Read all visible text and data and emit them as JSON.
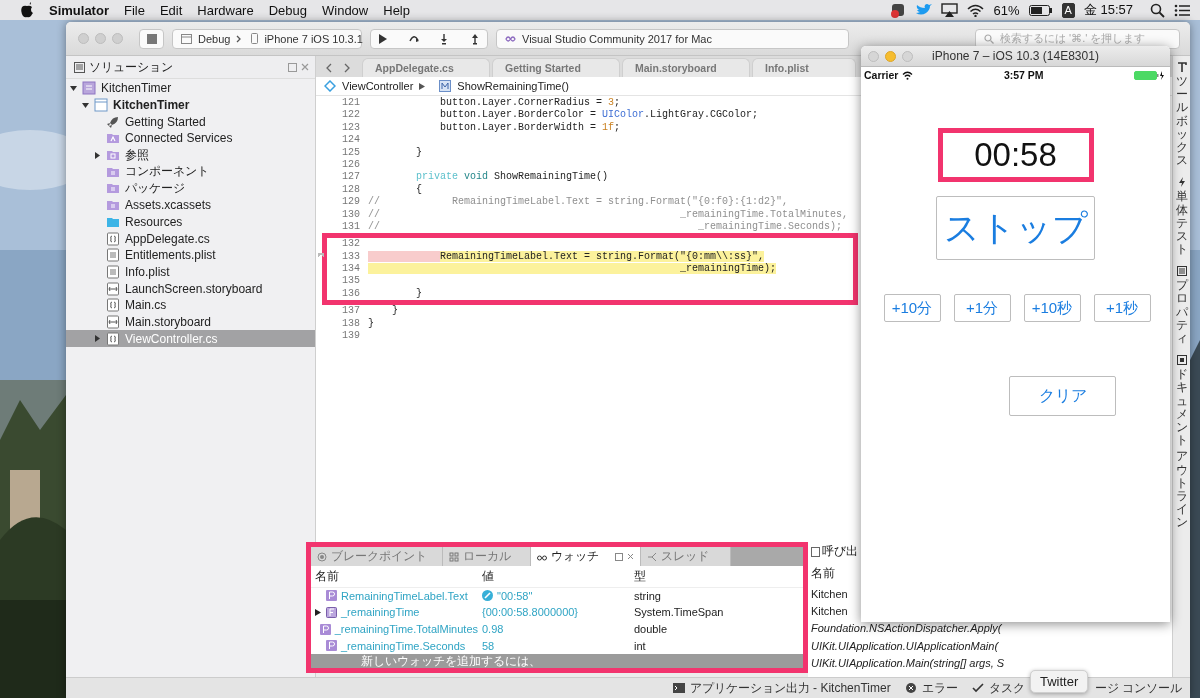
{
  "menubar": {
    "app_name": "Simulator",
    "menus": [
      "File",
      "Edit",
      "Hardware",
      "Debug",
      "Window",
      "Help"
    ],
    "battery_percent": "61%",
    "input_source": "A",
    "clock": "金 15:57"
  },
  "toolbar": {
    "configuration": "Debug",
    "device": "iPhone 7 iOS 10.3.1",
    "status": "Visual Studio Community 2017 for Mac",
    "search_placeholder": "検索するには '⌘.' を押します"
  },
  "solution_pad": {
    "title": "ソリューション",
    "tree": [
      {
        "label": "KitchenTimer",
        "kind": "solution",
        "expanded": true,
        "selected": false,
        "children": [
          {
            "label": "KitchenTimer",
            "kind": "project",
            "expanded": true,
            "selected": false,
            "children": [
              {
                "label": "Getting Started",
                "kind": "rocket",
                "selected": false
              },
              {
                "label": "Connected Services",
                "kind": "services",
                "selected": false
              },
              {
                "label": "参照",
                "kind": "references",
                "expanded": false,
                "selected": false
              },
              {
                "label": "コンポーネント",
                "kind": "special-folder",
                "selected": false
              },
              {
                "label": "パッケージ",
                "kind": "special-folder",
                "selected": false
              },
              {
                "label": "Assets.xcassets",
                "kind": "special-folder",
                "selected": false
              },
              {
                "label": "Resources",
                "kind": "folder",
                "selected": false
              },
              {
                "label": "AppDelegate.cs",
                "kind": "code",
                "selected": false
              },
              {
                "label": "Entitlements.plist",
                "kind": "plist",
                "selected": false
              },
              {
                "label": "Info.plist",
                "kind": "plist",
                "selected": false
              },
              {
                "label": "LaunchScreen.storyboard",
                "kind": "storyboard",
                "selected": false
              },
              {
                "label": "Main.cs",
                "kind": "code",
                "selected": false
              },
              {
                "label": "Main.storyboard",
                "kind": "storyboard",
                "selected": false
              },
              {
                "label": "ViewController.cs",
                "kind": "code",
                "expanded": false,
                "selected": true
              }
            ]
          }
        ]
      }
    ]
  },
  "editor": {
    "tabs": [
      {
        "label": "AppDelegate.cs",
        "selected": false
      },
      {
        "label": "Getting Started",
        "selected": false
      },
      {
        "label": "Main.storyboard",
        "selected": false
      },
      {
        "label": "Info.plist",
        "selected": false
      }
    ],
    "breadcrumb": [
      "ViewController",
      "ShowRemainingTime()"
    ],
    "blocks": [
      {
        "framed": false,
        "lines": [
          {
            "number": "121",
            "current": false,
            "breakpoint": false,
            "segments": [
              {
                "text": "            button.Layer.CornerRadius = ",
                "kind": "plain"
              },
              {
                "text": "3",
                "kind": "number"
              },
              {
                "text": ";",
                "kind": "plain"
              }
            ]
          },
          {
            "number": "122",
            "current": false,
            "breakpoint": false,
            "segments": [
              {
                "text": "            button.Layer.BorderColor = ",
                "kind": "plain"
              },
              {
                "text": "UIColor",
                "kind": "type"
              },
              {
                "text": ".LightGray.CGColor;",
                "kind": "plain"
              }
            ]
          },
          {
            "number": "123",
            "current": false,
            "breakpoint": false,
            "segments": [
              {
                "text": "            button.Layer.BorderWidth = ",
                "kind": "plain"
              },
              {
                "text": "1f",
                "kind": "number"
              },
              {
                "text": ";",
                "kind": "plain"
              }
            ]
          },
          {
            "number": "124",
            "current": false,
            "breakpoint": false
          },
          {
            "number": "125",
            "current": false,
            "breakpoint": false,
            "segments": [
              {
                "text": "        }",
                "kind": "plain"
              }
            ]
          },
          {
            "number": "126",
            "current": false,
            "breakpoint": false
          },
          {
            "number": "127",
            "current": false,
            "breakpoint": false,
            "segments": [
              {
                "text": "        private",
                "kind": "modifier"
              },
              {
                "text": " void",
                "kind": "keyword"
              },
              {
                "text": " ShowRemainingTime()",
                "kind": "plain"
              }
            ]
          },
          {
            "number": "128",
            "current": false,
            "breakpoint": false,
            "segments": [
              {
                "text": "        {",
                "kind": "plain"
              }
            ]
          },
          {
            "number": "129",
            "current": false,
            "breakpoint": false,
            "segments": [
              {
                "text": "//            RemainingTimeLabel.Text = string.Format(\"{0:f0}:{1:d2}\",",
                "kind": "comment"
              }
            ]
          },
          {
            "number": "130",
            "current": false,
            "breakpoint": false,
            "segments": [
              {
                "text": "//                                                  _remainingTime.TotalMinutes,",
                "kind": "comment"
              }
            ]
          },
          {
            "number": "131",
            "current": false,
            "breakpoint": false,
            "segments": [
              {
                "text": "//                                                     _remainingTime.Seconds);",
                "kind": "comment"
              }
            ]
          }
        ]
      },
      {
        "framed": true,
        "lines": [
          {
            "number": "132",
            "current": false,
            "breakpoint": false
          },
          {
            "number": "133",
            "current": true,
            "breakpoint": true,
            "segments": [
              {
                "text": "            RemainingTimeLabel.Text = string.Format(\"{0:mm\\\\:ss}\",",
                "kind": "plain"
              }
            ]
          },
          {
            "number": "134",
            "current": true,
            "breakpoint": false,
            "segments": [
              {
                "text": "                                                    _remainingTime);",
                "kind": "plain"
              }
            ]
          },
          {
            "number": "135",
            "current": false,
            "breakpoint": false
          },
          {
            "number": "136",
            "current": false,
            "breakpoint": false,
            "segments": [
              {
                "text": "        }",
                "kind": "plain"
              }
            ]
          }
        ]
      },
      {
        "framed": false,
        "lines": [
          {
            "number": "137",
            "current": false,
            "breakpoint": false,
            "segments": [
              {
                "text": "    }",
                "kind": "plain"
              }
            ]
          },
          {
            "number": "138",
            "current": false,
            "breakpoint": false,
            "segments": [
              {
                "text": "}",
                "kind": "plain"
              }
            ]
          },
          {
            "number": "139",
            "current": false,
            "breakpoint": false
          }
        ]
      }
    ]
  },
  "watch_pad": {
    "framed": true,
    "tabs": [
      {
        "label": "ブレークポイント",
        "kind": "breakpoints",
        "selected": false
      },
      {
        "label": "ローカル",
        "kind": "locals",
        "selected": false
      },
      {
        "label": "ウォッチ",
        "kind": "watch",
        "selected": true
      },
      {
        "label": "スレッド",
        "kind": "threads",
        "selected": false
      }
    ],
    "columns": [
      "名前",
      "値",
      "型"
    ],
    "rows": [
      {
        "name": "RemainingTimeLabel.Text",
        "kind": "property",
        "value": "\"00:58\"",
        "editable": true,
        "type": "string"
      },
      {
        "name": "_remainingTime",
        "kind": "field",
        "expanded": false,
        "value": "{00:00:58.8000000}",
        "editable": false,
        "type": "System.TimeSpan"
      },
      {
        "name": "_remainingTime.TotalMinutes",
        "kind": "property",
        "value": "0.98",
        "editable": false,
        "type": "double"
      },
      {
        "name": "_remainingTime.Seconds",
        "kind": "property",
        "value": "58",
        "editable": false,
        "type": "int"
      }
    ],
    "add_hint": "新しいウォッチを追加するには、"
  },
  "call_stack_pad": {
    "title": "呼び出",
    "column": "名前",
    "rows": [
      {
        "text": "Kitchen",
        "external": false
      },
      {
        "text": "Kitchen",
        "external": false
      },
      {
        "text": "Foundation.NSActionDispatcher.Apply(",
        "external": true
      },
      {
        "text": "UIKit.UIApplication.UIApplicationMain(",
        "external": true
      },
      {
        "text": "UIKit.UIApplication.Main(string[] args, S",
        "external": true
      }
    ]
  },
  "status_bar": [
    {
      "label": "アプリケーション出力 - KitchenTimer",
      "kind": "output"
    },
    {
      "label": "エラー",
      "kind": "errors"
    },
    {
      "label": "タスク",
      "kind": "tasks"
    },
    {
      "label": "ージ コンソール",
      "kind": "console"
    }
  ],
  "side_tabs": [
    {
      "label_parts": [
        "ツールボックス"
      ],
      "kind": "toolbox"
    },
    {
      "label_parts": [
        "単体テスト"
      ],
      "kind": "tests"
    },
    {
      "label_parts": [
        "プロパティ"
      ],
      "kind": "properties"
    },
    {
      "label_parts": [
        "ドキュメント",
        "アウトライン"
      ],
      "kind": "outline"
    }
  ],
  "simulator": {
    "title": "iPhone 7 – iOS 10.3 (14E8301)",
    "carrier": "Carrier",
    "time": "3:57 PM",
    "timer": "00:58",
    "timer_framed": true,
    "stop_button": "ストップ",
    "add_buttons": [
      "+10分",
      "+1分",
      "+10秒",
      "+1秒"
    ],
    "clear_button": "クリア"
  },
  "tooltip": "Twitter"
}
